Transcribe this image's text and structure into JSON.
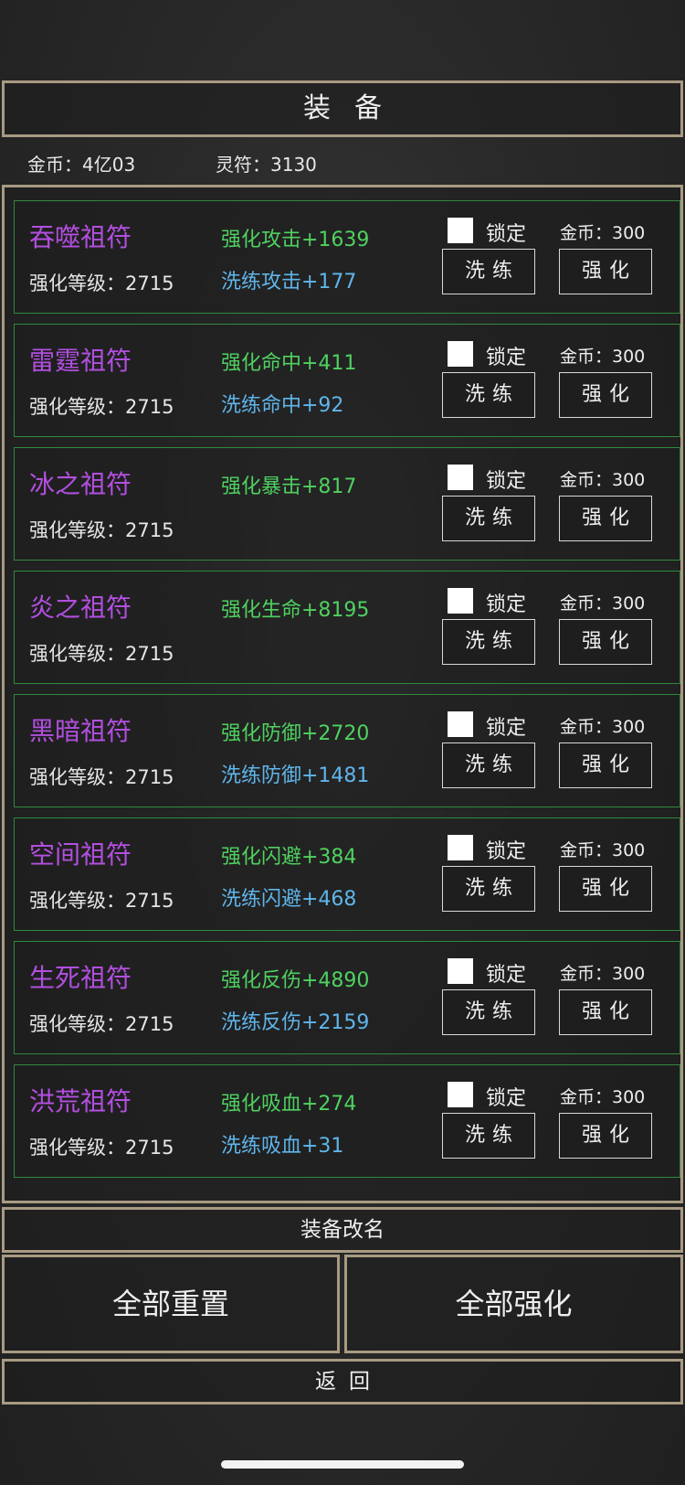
{
  "header": {
    "title": "装备"
  },
  "currency": {
    "gold": "金币：4亿03",
    "talisman": "灵符：3130"
  },
  "items": [
    {
      "name": "吞噬祖符",
      "level": "强化等级：2715",
      "enhance": "强化攻击+1639",
      "refine": "洗练攻击+177",
      "lock": "锁定",
      "cost": "金币：300",
      "refine_btn": "洗练",
      "enhance_btn": "强化"
    },
    {
      "name": "雷霆祖符",
      "level": "强化等级：2715",
      "enhance": "强化命中+411",
      "refine": "洗练命中+92",
      "lock": "锁定",
      "cost": "金币：300",
      "refine_btn": "洗练",
      "enhance_btn": "强化"
    },
    {
      "name": "冰之祖符",
      "level": "强化等级：2715",
      "enhance": "强化暴击+817",
      "refine": "",
      "lock": "锁定",
      "cost": "金币：300",
      "refine_btn": "洗练",
      "enhance_btn": "强化"
    },
    {
      "name": "炎之祖符",
      "level": "强化等级：2715",
      "enhance": "强化生命+8195",
      "refine": "",
      "lock": "锁定",
      "cost": "金币：300",
      "refine_btn": "洗练",
      "enhance_btn": "强化"
    },
    {
      "name": "黑暗祖符",
      "level": "强化等级：2715",
      "enhance": "强化防御+2720",
      "refine": "洗练防御+1481",
      "lock": "锁定",
      "cost": "金币：300",
      "refine_btn": "洗练",
      "enhance_btn": "强化"
    },
    {
      "name": "空间祖符",
      "level": "强化等级：2715",
      "enhance": "强化闪避+384",
      "refine": "洗练闪避+468",
      "lock": "锁定",
      "cost": "金币：300",
      "refine_btn": "洗练",
      "enhance_btn": "强化"
    },
    {
      "name": "生死祖符",
      "level": "强化等级：2715",
      "enhance": "强化反伤+4890",
      "refine": "洗练反伤+2159",
      "lock": "锁定",
      "cost": "金币：300",
      "refine_btn": "洗练",
      "enhance_btn": "强化"
    },
    {
      "name": "洪荒祖符",
      "level": "强化等级：2715",
      "enhance": "强化吸血+274",
      "refine": "洗练吸血+31",
      "lock": "锁定",
      "cost": "金币：300",
      "refine_btn": "洗练",
      "enhance_btn": "强化"
    }
  ],
  "footer": {
    "rename": "装备改名",
    "reset_all": "全部重置",
    "enhance_all": "全部强化",
    "back": "返回"
  },
  "colors": {
    "frame_border": "#a89a82",
    "card_border": "#2f8a3c",
    "item_name": "#b24fe0",
    "enhance_stat": "#4fd160",
    "refine_stat": "#5fb5ea"
  }
}
